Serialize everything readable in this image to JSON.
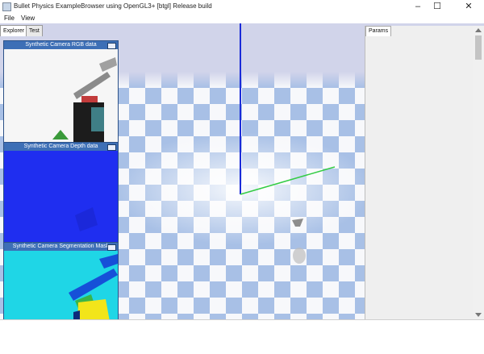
{
  "window": {
    "title": "Bullet Physics ExampleBrowser using OpenGL3+ [btgl] Release build",
    "minimize_glyph": "–",
    "maximize_glyph": "☐",
    "close_glyph": "✕"
  },
  "menu": {
    "file": "File",
    "view": "View"
  },
  "explorer": {
    "tab_explorer": "Explorer",
    "tab_test": "Test"
  },
  "panels": {
    "rgb_title": "Synthetic Camera RGB data",
    "depth_title": "Synthetic Camera Depth data",
    "seg_title": "Synthetic Camera Segmentation Mask"
  },
  "params": {
    "tab_label": "Params"
  },
  "colors": {
    "floor_blue": "#a8c0e6",
    "floor_white": "#f7f8fb",
    "sky": "#d1d4ea",
    "axis_blue": "#1a2bd9",
    "axis_green": "#33cc44",
    "depth_blue": "#1f2ef0",
    "seg_cyan": "#1fd6e6",
    "seg_yellow": "#f2e51a",
    "panel_header": "#3d6fb6"
  }
}
